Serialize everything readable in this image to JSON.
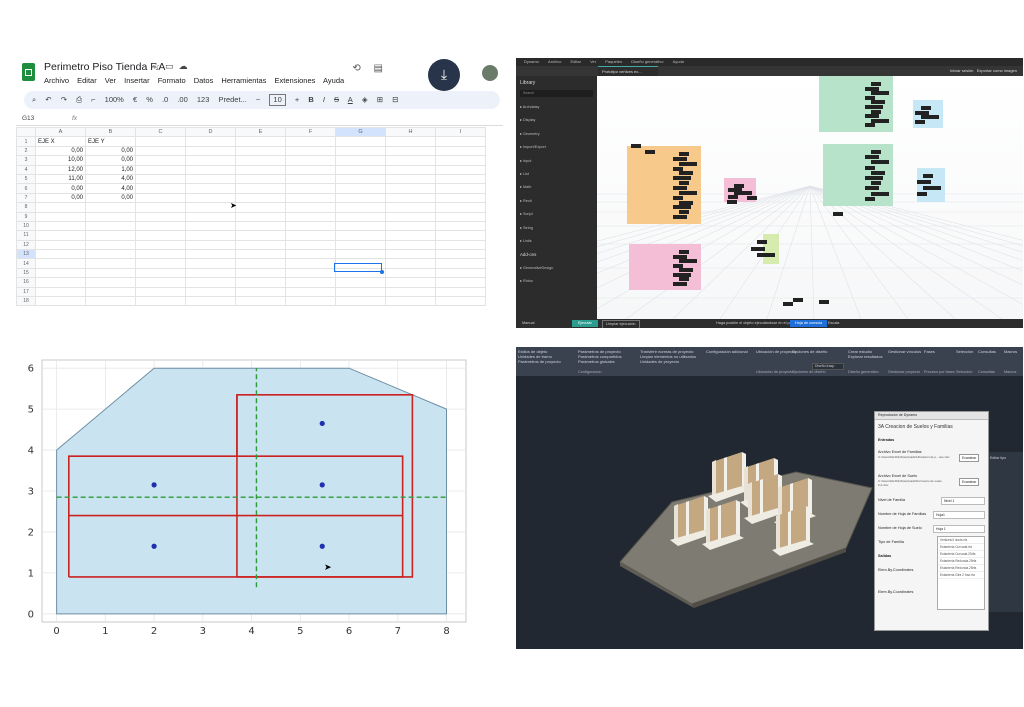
{
  "sheets": {
    "title": "Perimetro Piso Tienda F.A",
    "menu": [
      "Archivo",
      "Editar",
      "Ver",
      "Insertar",
      "Formato",
      "Datos",
      "Herramientas",
      "Extensiones",
      "Ayuda"
    ],
    "toolbar": {
      "zoom": "100%",
      "currency": "€",
      "percent": "%",
      "dec_down": ".0",
      "dec_up": ".00",
      "format_123": "123",
      "font": "Predet...",
      "font_size": "10"
    },
    "cell_ref": "G13",
    "fx": "fx",
    "columns": [
      "A",
      "B",
      "C",
      "D",
      "E",
      "F",
      "G",
      "H",
      "I"
    ],
    "rows": [
      [
        "EJE X",
        "EJE Y"
      ],
      [
        "0,00",
        "0,00"
      ],
      [
        "10,00",
        "0,00"
      ],
      [
        "12,00",
        "1,00"
      ],
      [
        "11,00",
        "4,00"
      ],
      [
        "0,00",
        "4,00"
      ],
      [
        "0,00",
        "0,00"
      ]
    ],
    "row_numbers": [
      "1",
      "2",
      "3",
      "4",
      "5",
      "6",
      "7",
      "8",
      "9",
      "10",
      "11",
      "12",
      "13",
      "14",
      "15",
      "16",
      "17",
      "18"
    ],
    "selected_row": "13"
  },
  "dynamo": {
    "menu": [
      "Dynamo",
      "Archivo",
      "Editar",
      "Ver",
      "Paquetes",
      "Diseño generativo",
      "Ayuda"
    ],
    "tab": "Prototipo vertices ec...",
    "top_right": [
      "Iniciar sesión",
      "Exportar como imagen"
    ],
    "library_title": "Library",
    "search": "Search",
    "library_items": [
      "Archdaisy",
      "Display",
      "Geometry",
      "Import/Export",
      "Input",
      "List",
      "Math",
      "Revit",
      "Script",
      "String",
      "Units",
      "Add-ons",
      "GenerativeDesign",
      "Rhino"
    ],
    "footer": {
      "mode": "Manual",
      "run": "Ejecutar",
      "clear": "Limpiar ejecución",
      "message": "Haga posible el objeto ejecutándose en el panel",
      "zoom": "Hoja de consola",
      "ext": "Escala"
    },
    "group_colors": [
      "#f7c98b",
      "#f4bed6",
      "#b8e3cb",
      "#c6e7f5",
      "#d5ecae"
    ]
  },
  "plot": {
    "chart_data": {
      "type": "line",
      "title": "",
      "xlabel": "",
      "ylabel": "",
      "xlim": [
        -0.3,
        8.4
      ],
      "ylim": [
        -0.2,
        6.2
      ],
      "x_ticks": [
        "0",
        "1",
        "2",
        "3",
        "4",
        "5",
        "6",
        "7",
        "8"
      ],
      "y_ticks": [
        "0",
        "1",
        "2",
        "3",
        "4",
        "5",
        "6"
      ],
      "grid": true,
      "series": [
        {
          "kind": "polygon",
          "fill": "#c9e4f0",
          "stroke": "#6f8fa5",
          "x": [
            0,
            8,
            8,
            6,
            2,
            0,
            0
          ],
          "y": [
            0,
            0,
            5,
            6,
            6,
            4,
            0
          ]
        },
        {
          "kind": "rect",
          "stroke": "#cc2222",
          "x": [
            0.25,
            7.1,
            7.1,
            0.25,
            0.25
          ],
          "y": [
            0.9,
            0.9,
            3.85,
            3.85,
            0.9
          ]
        },
        {
          "kind": "rect",
          "stroke": "#cc2222",
          "x": [
            3.7,
            7.3,
            7.3,
            3.7,
            3.7
          ],
          "y": [
            0.9,
            0.9,
            5.35,
            5.35,
            0.9
          ]
        },
        {
          "kind": "hline",
          "stroke": "#cc2222",
          "x": [
            0.25,
            7.1
          ],
          "y": [
            2.4,
            2.4
          ]
        },
        {
          "kind": "vline",
          "stroke": "#cc2222",
          "x": [
            3.7,
            3.7
          ],
          "y": [
            3.85,
            5.35
          ]
        },
        {
          "kind": "dashed",
          "stroke": "#2f9a3a",
          "x": [
            0,
            8
          ],
          "y": [
            2.85,
            2.85
          ]
        },
        {
          "kind": "dashed",
          "stroke": "#2f9a3a",
          "x": [
            4.1,
            4.1
          ],
          "y": [
            0.65,
            6
          ]
        },
        {
          "kind": "points",
          "color": "#1f2fb0",
          "x": [
            2,
            2,
            5.45,
            5.45,
            5.45
          ],
          "y": [
            3.15,
            1.65,
            4.65,
            3.15,
            1.65
          ]
        }
      ]
    }
  },
  "revit": {
    "ribbon_groups": [
      {
        "lines": [
          "Estilos de objeto",
          "Unidades de tramo",
          "Parámetros de proyecto"
        ],
        "label": ""
      },
      {
        "lines": [
          "Parámetros de proyecto",
          "Parámetros compartidos",
          "Parámetros globales"
        ],
        "label": "Configuración"
      },
      {
        "lines": [
          "Transferir normas de proyecto",
          "Limpiar elementos no utilizados",
          "Unidades de proyecto"
        ],
        "label": ""
      },
      {
        "lines": [
          "Configuración adicional"
        ],
        "label": ""
      },
      {
        "lines": [
          "Ubicación de proyecto"
        ],
        "label": "Ubicación de proyecto"
      },
      {
        "lines": [
          "Opciones de diseño"
        ],
        "label": "Opciones de diseño"
      },
      {
        "lines": [
          "Crear estudio",
          "Explorar resultados"
        ],
        "label": "Diseño generativo"
      },
      {
        "lines": [
          "Gestionar vínculos"
        ],
        "label": "Gestionar proyecto"
      },
      {
        "lines": [
          "Fases"
        ],
        "label": "Proceso por fases"
      },
      {
        "lines": [
          "Selección"
        ],
        "label": "Selección"
      },
      {
        "lines": [
          "Consultas"
        ],
        "label": "Consultas"
      },
      {
        "lines": [
          "Macros"
        ],
        "label": "Macros"
      }
    ],
    "design_options_value": "Diseño trasp.",
    "dialog": {
      "title": "Reproductor de Dynamo",
      "heading": "3A Creacion de Suelos y Familias",
      "inputs_label": "Entradas",
      "excel_familias_label": "Archivo Excel de Familias",
      "excel_familias_value": "C:\\Users\\ReXDivDownloads\\Ubicación de p...nes.xlsx",
      "browse": "Examinar",
      "excel_suelo_label": "Archivo Excel de Suelo",
      "excel_suelo_value": "C:\\Users\\ReXDivDownloads\\Perímetro de suelo F.A.xlsx",
      "nivel_familia_label": "Nivel de Familia",
      "nivel_familia_value": "Nivel 1",
      "nombre_hoja_familias_label": "Nombre de Hoja de Familias",
      "nombre_hoja_familias_value": "Hoja1",
      "nombre_hoja_suelo_label": "Nombre de Hoja de Suelo",
      "nombre_hoja_suelo_value": "Hoja 1",
      "tipo_familia_label": "Tipo de Familia",
      "tipo_familia_value": "Mbp rectangular.rfa",
      "outputs_label": "Salidas",
      "out1": "Elem.By.Coordinates",
      "out2": "Elem.By.Coordinates",
      "dropdown_items": [
        "Vertices/4 ducts.rfa",
        "Estanteria Curvada.rfa",
        "Estanteria Curvada.25rfa",
        "Estanteria Redonda.25rfa",
        "Estanteria Redonda.25rfa",
        "Estanteria Gira 2 fraz.rfa"
      ]
    },
    "side_value": "Editar tipo"
  }
}
